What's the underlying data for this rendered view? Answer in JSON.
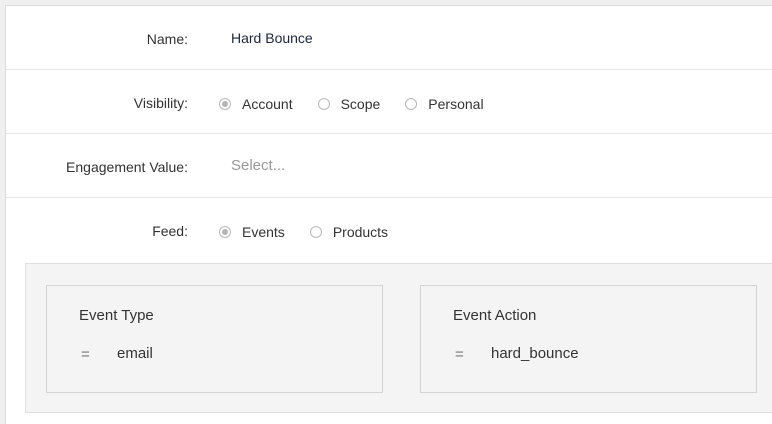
{
  "form": {
    "name": {
      "label": "Name:",
      "value": "Hard Bounce"
    },
    "visibility": {
      "label": "Visibility:",
      "options": [
        "Account",
        "Scope",
        "Personal"
      ],
      "selected": "Account"
    },
    "engagement": {
      "label": "Engagement Value:",
      "placeholder": "Select..."
    },
    "feed": {
      "label": "Feed:",
      "options": [
        "Events",
        "Products"
      ],
      "selected": "Events"
    }
  },
  "filters": [
    {
      "title": "Event Type",
      "operator": "=",
      "value": "email"
    },
    {
      "title": "Event Action",
      "operator": "=",
      "value": "hard_bounce"
    }
  ]
}
